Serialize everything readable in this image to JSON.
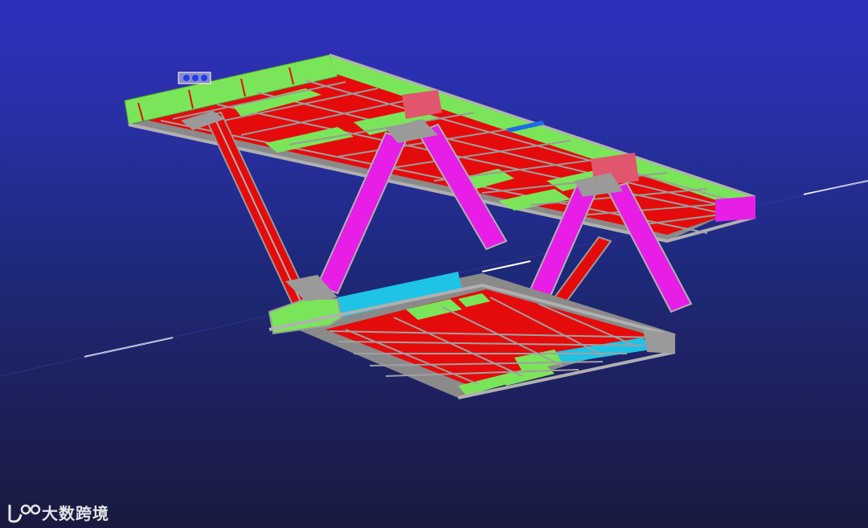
{
  "scene": {
    "description_label": "",
    "watermark_text": "大数跨境",
    "watermark_logo": "BDO-logo",
    "colors": {
      "background_top": "#2f2fbe",
      "background_bottom": "#1a1a40",
      "plate_red": "#f20a0a",
      "plate_green": "#7be55a",
      "plate_magenta": "#e61ee6",
      "plate_cyan": "#1ec3e6",
      "plate_gray": "#9a9a9a",
      "edge_gray": "#b8b8b8",
      "axis_line": "#ffffff"
    }
  }
}
